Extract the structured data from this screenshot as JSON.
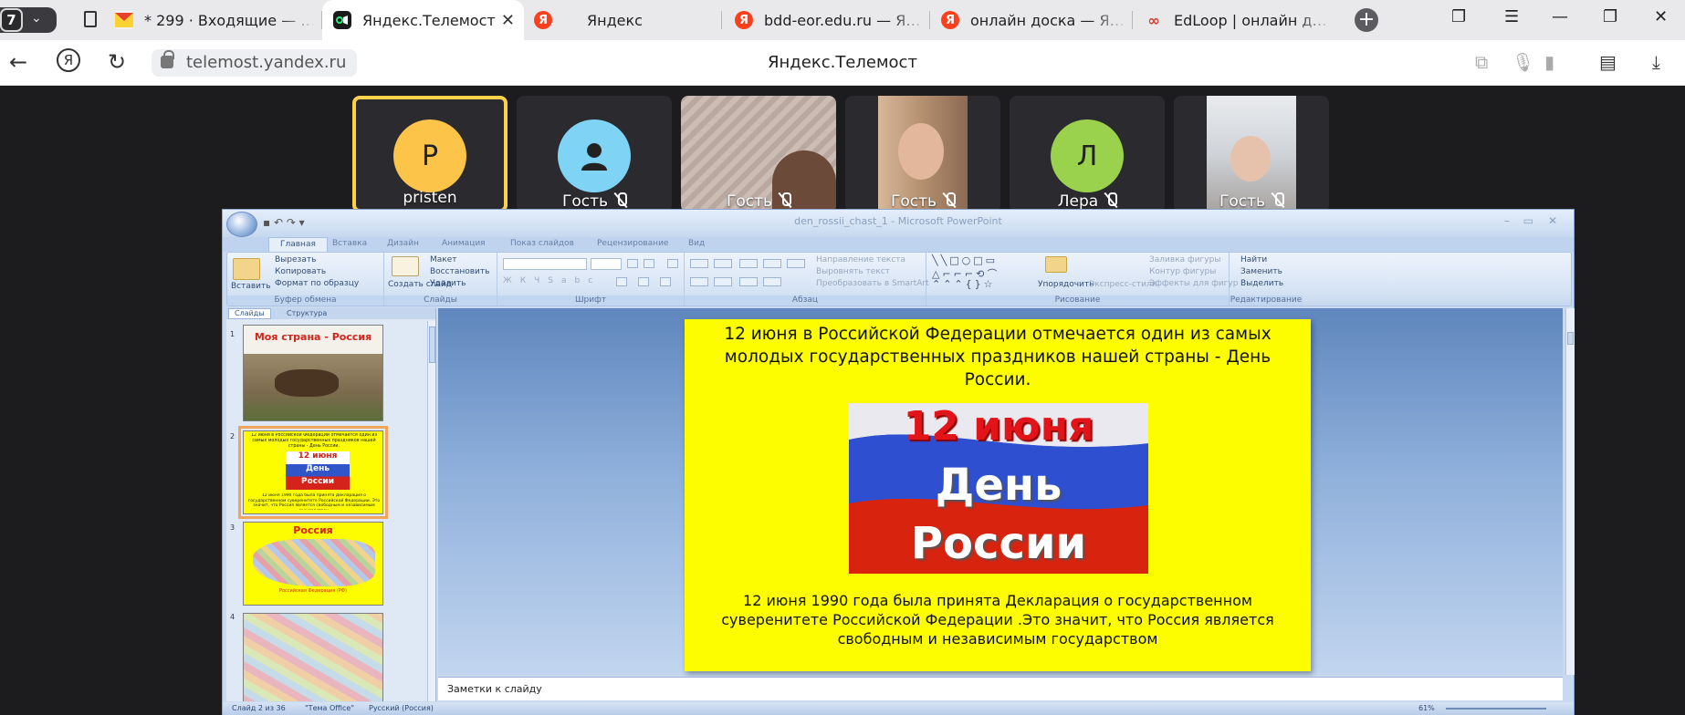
{
  "browser": {
    "tab_count": "7",
    "tabs": [
      {
        "label": "* 299 · Входящие — Янд",
        "favicon": "mail-icon",
        "color": "#e6402f"
      },
      {
        "label": "Яндекс.Телемост",
        "favicon": "telemost-icon",
        "color": "#1a1a1a",
        "active": true
      },
      {
        "label": "Яндекс",
        "favicon": "yandex-icon",
        "color": "#fc3f1d"
      },
      {
        "label": "bdd-eor.edu.ru — Янде",
        "favicon": "yandex-icon",
        "color": "#fc3f1d"
      },
      {
        "label": "онлайн доска — Янде",
        "favicon": "yandex-icon",
        "color": "#fc3f1d"
      },
      {
        "label": "EdLoop | онлайн доска",
        "favicon": "edloop-icon",
        "color": "#e03a2b"
      }
    ],
    "url": "telemost.yandex.ru",
    "page_title": "Яндекс.Телемост"
  },
  "participants": [
    {
      "name": "pristen",
      "initial": "P",
      "avatar_color": "#fcc54a",
      "speaking": true,
      "muted": false
    },
    {
      "name": "Гость",
      "initial": "",
      "avatar_color": "#7fd3f5",
      "speaking": false,
      "muted": true
    },
    {
      "name": "Гость",
      "video": true,
      "muted": true
    },
    {
      "name": "Гость",
      "video": true,
      "muted": true
    },
    {
      "name": "Лера",
      "initial": "Л",
      "avatar_color": "#9ad24d",
      "speaking": false,
      "muted": true
    },
    {
      "name": "Гость",
      "video": true,
      "muted": true
    }
  ],
  "ppt": {
    "caption": "den_rossii_chast_1 - Microsoft PowerPoint",
    "tabs": [
      "Главная",
      "Вставка",
      "Дизайн",
      "Анимация",
      "Показ слайдов",
      "Рецензирование",
      "Вид"
    ],
    "groups": {
      "clipboard": {
        "title": "Буфер обмена",
        "paste": "Вставить",
        "cut": "Вырезать",
        "copy": "Копировать",
        "format": "Формат по образцу"
      },
      "slides": {
        "title": "Слайды",
        "new": "Создать слайд",
        "layout": "Макет",
        "reset": "Восстановить",
        "delete": "Удалить"
      },
      "font": {
        "title": "Шрифт"
      },
      "paragraph": {
        "title": "Абзац",
        "dir": "Направление текста",
        "align": "Выровнять текст",
        "smartart": "Преобразовать в SmartArt"
      },
      "drawing": {
        "title": "Рисование",
        "arrange": "Упорядочить",
        "styles": "Экспресс-стили",
        "fill": "Заливка фигуры",
        "outline": "Контур фигуры",
        "effects": "Эффекты для фигур"
      },
      "editing": {
        "title": "Редактирование",
        "find": "Найти",
        "replace": "Заменить",
        "select": "Выделить"
      }
    },
    "panel_tabs": [
      "Слайды",
      "Структура"
    ],
    "thumbs": [
      {
        "num": "1",
        "title": "Моя страна - Россия"
      },
      {
        "num": "2",
        "top": "12 июня в Российской Федерации отмечается один из самых молодых государственных праздников нашей страны - День России.",
        "bottom": "12 июня 1990 года была принята Декларация о государственном суверенитете Российской Федерации. Это значит, что Россия является свободным и независимым государством"
      },
      {
        "num": "3",
        "title": "Россия",
        "subtitle": "Российская Федерация (РФ)"
      },
      {
        "num": "4"
      }
    ],
    "slide": {
      "top_text": "12 июня в Российской Федерации отмечается один из самых молодых государственных праздников нашей страны - День России.",
      "image_line1": "12 июня",
      "image_line2": "День",
      "image_line3": "России",
      "bottom_text": "12 июня  1990 года была принята Декларация о государственном суверенитете Российской Федерации .Это значит, что Россия является свободным и независимым государством"
    },
    "notes_placeholder": "Заметки к слайду",
    "status": {
      "slide": "Слайд 2 из 36",
      "theme": "\"Тема Office\"",
      "lang": "Русский (Россия)",
      "zoom": "61%"
    }
  }
}
